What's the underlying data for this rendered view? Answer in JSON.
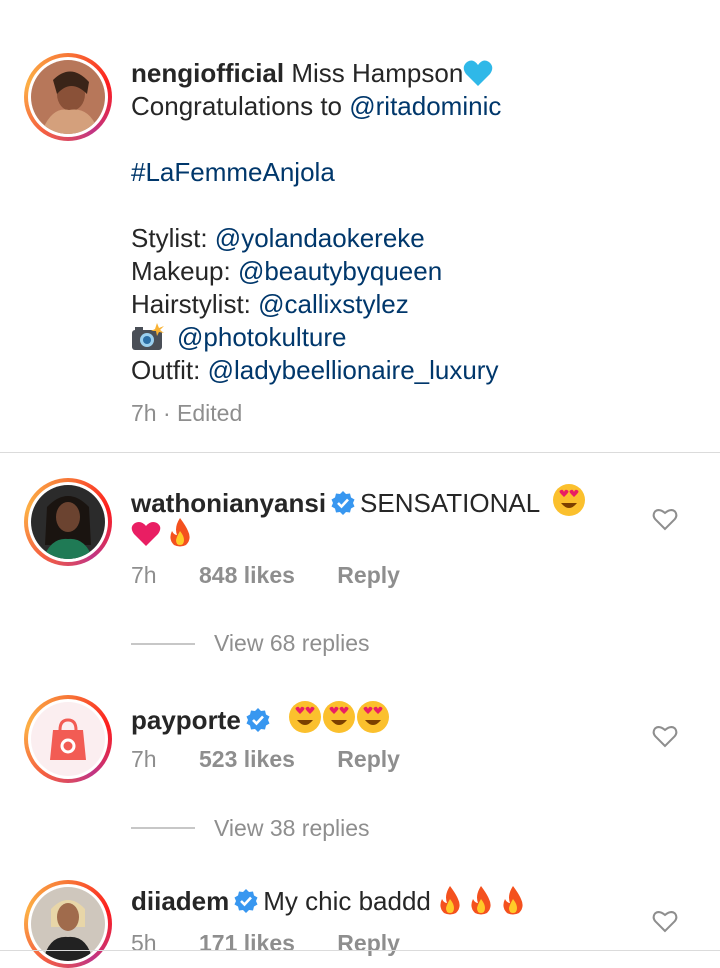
{
  "caption": {
    "username": "nengiofficial",
    "line1_rest": "Miss Hampson",
    "line2_prefix": "Congratulations to ",
    "line2_mention": "@ritadominic",
    "hashtag": "#LaFemmeAnjola",
    "stylist_label": "Stylist: ",
    "stylist_mention": "@yolandaokereke",
    "makeup_label": "Makeup: ",
    "makeup_mention": "@beautybyqueen",
    "hair_label": "Hairstylist: ",
    "hair_mention": "@callixstylez",
    "photo_mention": "@photokulture",
    "outfit_label": "Outfit: ",
    "outfit_mention": "@ladybeellionaire_luxury",
    "time": "7h · Edited"
  },
  "comments": [
    {
      "username": "wathonianyansi",
      "text": "SENSATIONAL",
      "time": "7h",
      "likes": "848 likes",
      "reply": "Reply",
      "view_replies": "View 68 replies"
    },
    {
      "username": "payporte",
      "text": "",
      "time": "7h",
      "likes": "523 likes",
      "reply": "Reply",
      "view_replies": "View 38 replies"
    },
    {
      "username": "diiadem",
      "text": "My chic baddd",
      "time": "5h",
      "likes": "171 likes",
      "reply": "Reply"
    }
  ],
  "colors": {
    "link": "#00376b",
    "verified": "#3897f0",
    "muted": "#8e8e8e"
  }
}
